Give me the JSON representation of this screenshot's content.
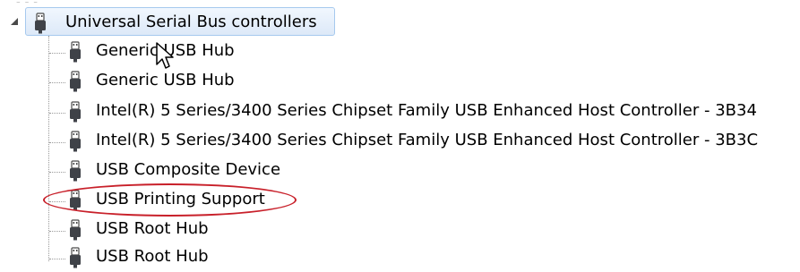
{
  "tree": {
    "category": {
      "label": "Universal Serial Bus controllers",
      "icon": "usb-connector-icon"
    },
    "devices": [
      {
        "label": "Generic USB Hub",
        "icon": "usb-connector-icon"
      },
      {
        "label": "Generic USB Hub",
        "icon": "usb-connector-icon"
      },
      {
        "label": "Intel(R) 5 Series/3400 Series Chipset Family USB Enhanced Host Controller - 3B34",
        "icon": "usb-connector-icon"
      },
      {
        "label": "Intel(R) 5 Series/3400 Series Chipset Family USB Enhanced Host Controller - 3B3C",
        "icon": "usb-connector-icon"
      },
      {
        "label": "USB Composite Device",
        "icon": "usb-connector-icon"
      },
      {
        "label": "USB Printing Support",
        "icon": "usb-connector-icon"
      },
      {
        "label": "USB Root Hub",
        "icon": "usb-connector-icon"
      },
      {
        "label": "USB Root Hub",
        "icon": "usb-connector-icon"
      }
    ]
  },
  "annotation": {
    "highlight_color": "#c8202a"
  },
  "colors": {
    "selection_border": "#a6c9ee",
    "icon_dark": "#3f4248",
    "tree_line": "#9a9a9a"
  }
}
